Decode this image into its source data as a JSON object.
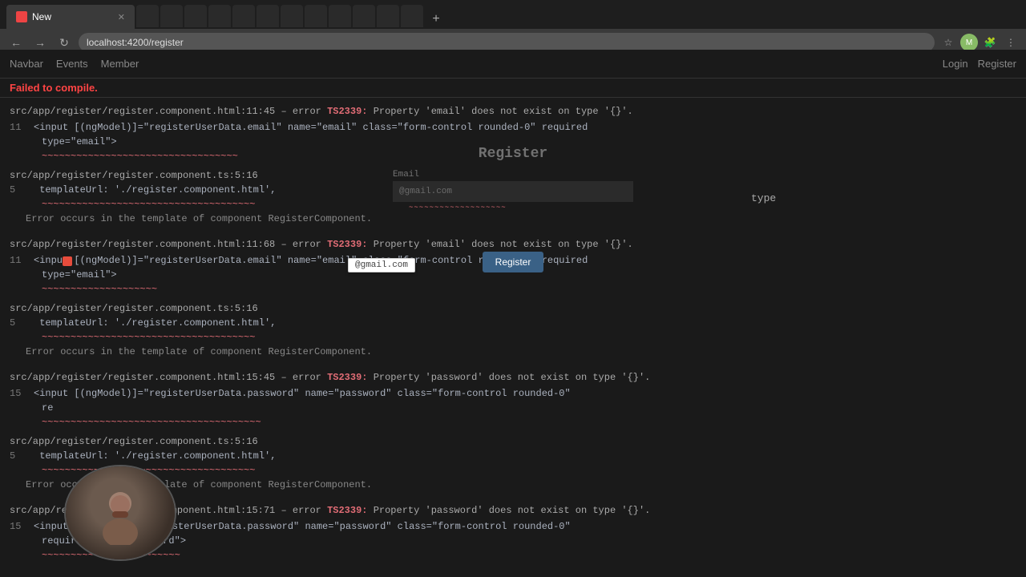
{
  "browser": {
    "tab_label": "New",
    "address": "localhost:4200/register",
    "close_icon": "✕",
    "back_icon": "←",
    "forward_icon": "→",
    "refresh_icon": "↻"
  },
  "app_navbar": {
    "links": [
      "Navbar",
      "Events",
      "Member"
    ],
    "right_links": [
      "Login",
      "Register"
    ]
  },
  "error_banner": {
    "text": "Failed to compile."
  },
  "errors": [
    {
      "id": "err1",
      "file": "src/app/register/register.component.html:11:45",
      "separator": " – error ",
      "error_code": "TS2339:",
      "message": " Property 'email' does not exist on type '{}'.",
      "line_number": "11",
      "code": "<input [(ngModel)]=\"registerUserData.email\" name=\"email\" class=\"form-control rounded-0\" required",
      "code_continued": "type=\"email\">",
      "squiggly": "~~~~~~~~~~~~~~~~~~~~~~~~~~~~~~~~~~",
      "template_file": "src/app/register/register.component.ts:5:16",
      "template_line": "5",
      "template_url": "templateUrl: './register.component.html',",
      "error_occurs": "Error occurs in the template of component RegisterComponent."
    },
    {
      "id": "err2",
      "file": "src/app/register/register.component.html:11:68",
      "separator": " – error ",
      "error_code": "TS2339:",
      "message": " Property 'email' does not exist on type '{}'.",
      "line_number": "11",
      "code": "<input [(ngModel)]=\"registerUserData.email\" name=\"email\" class=\"form-control rounded-0\" required",
      "code_continued": "type=\"email\">",
      "squiggly": "~~~~~~~~~~~~~~~~~~~~",
      "template_file": "src/app/register/register.component.ts:5:16",
      "template_line": "5",
      "template_url": "templateUrl: './register.component.html',",
      "error_occurs": "Error occurs in the template of component RegisterComponent."
    },
    {
      "id": "err3",
      "file": "src/app/register/register.component.html:15:45",
      "separator": " – error ",
      "error_code": "TS2339:",
      "message": " Property 'password' does not exist on type '{}'.",
      "line_number": "15",
      "code": "<input [(ngModel)]=\"registerUserData.password\" name=\"password\" class=\"form-control rounded-0\"",
      "code_continued": "re",
      "squiggly": "~~~~~~~~~~~~~~~~~~~~~~~~~~~~~~~~~~~~~~",
      "template_file": "src/app/register/register.component.ts:5:16",
      "template_line": "5",
      "template_url": "templateUrl: './register.component.html',",
      "error_occurs": "Error occurs in the template of component RegisterComponent."
    },
    {
      "id": "err4",
      "file": "src/app/register/register.component.html:15:71",
      "separator": " – error ",
      "error_code": "TS2339:",
      "message": " Property 'password' does not exist on type '{}'.",
      "line_number": "15",
      "code": "<input [(ngModel)]=\"registerUserData.password\" name=\"password\" class=\"form-control rounded-0\"",
      "code_continued": "required type=\"password\">",
      "squiggly": "~~~~~~~~~~~~~~~~~~~~~~~~"
    }
  ],
  "register_form": {
    "title": "Register",
    "email_label": "Email",
    "email_placeholder": "@gmail.com",
    "register_button": "Register"
  },
  "type_text": "type",
  "tooltip": {
    "email_suggestion": "@gmail.com"
  }
}
